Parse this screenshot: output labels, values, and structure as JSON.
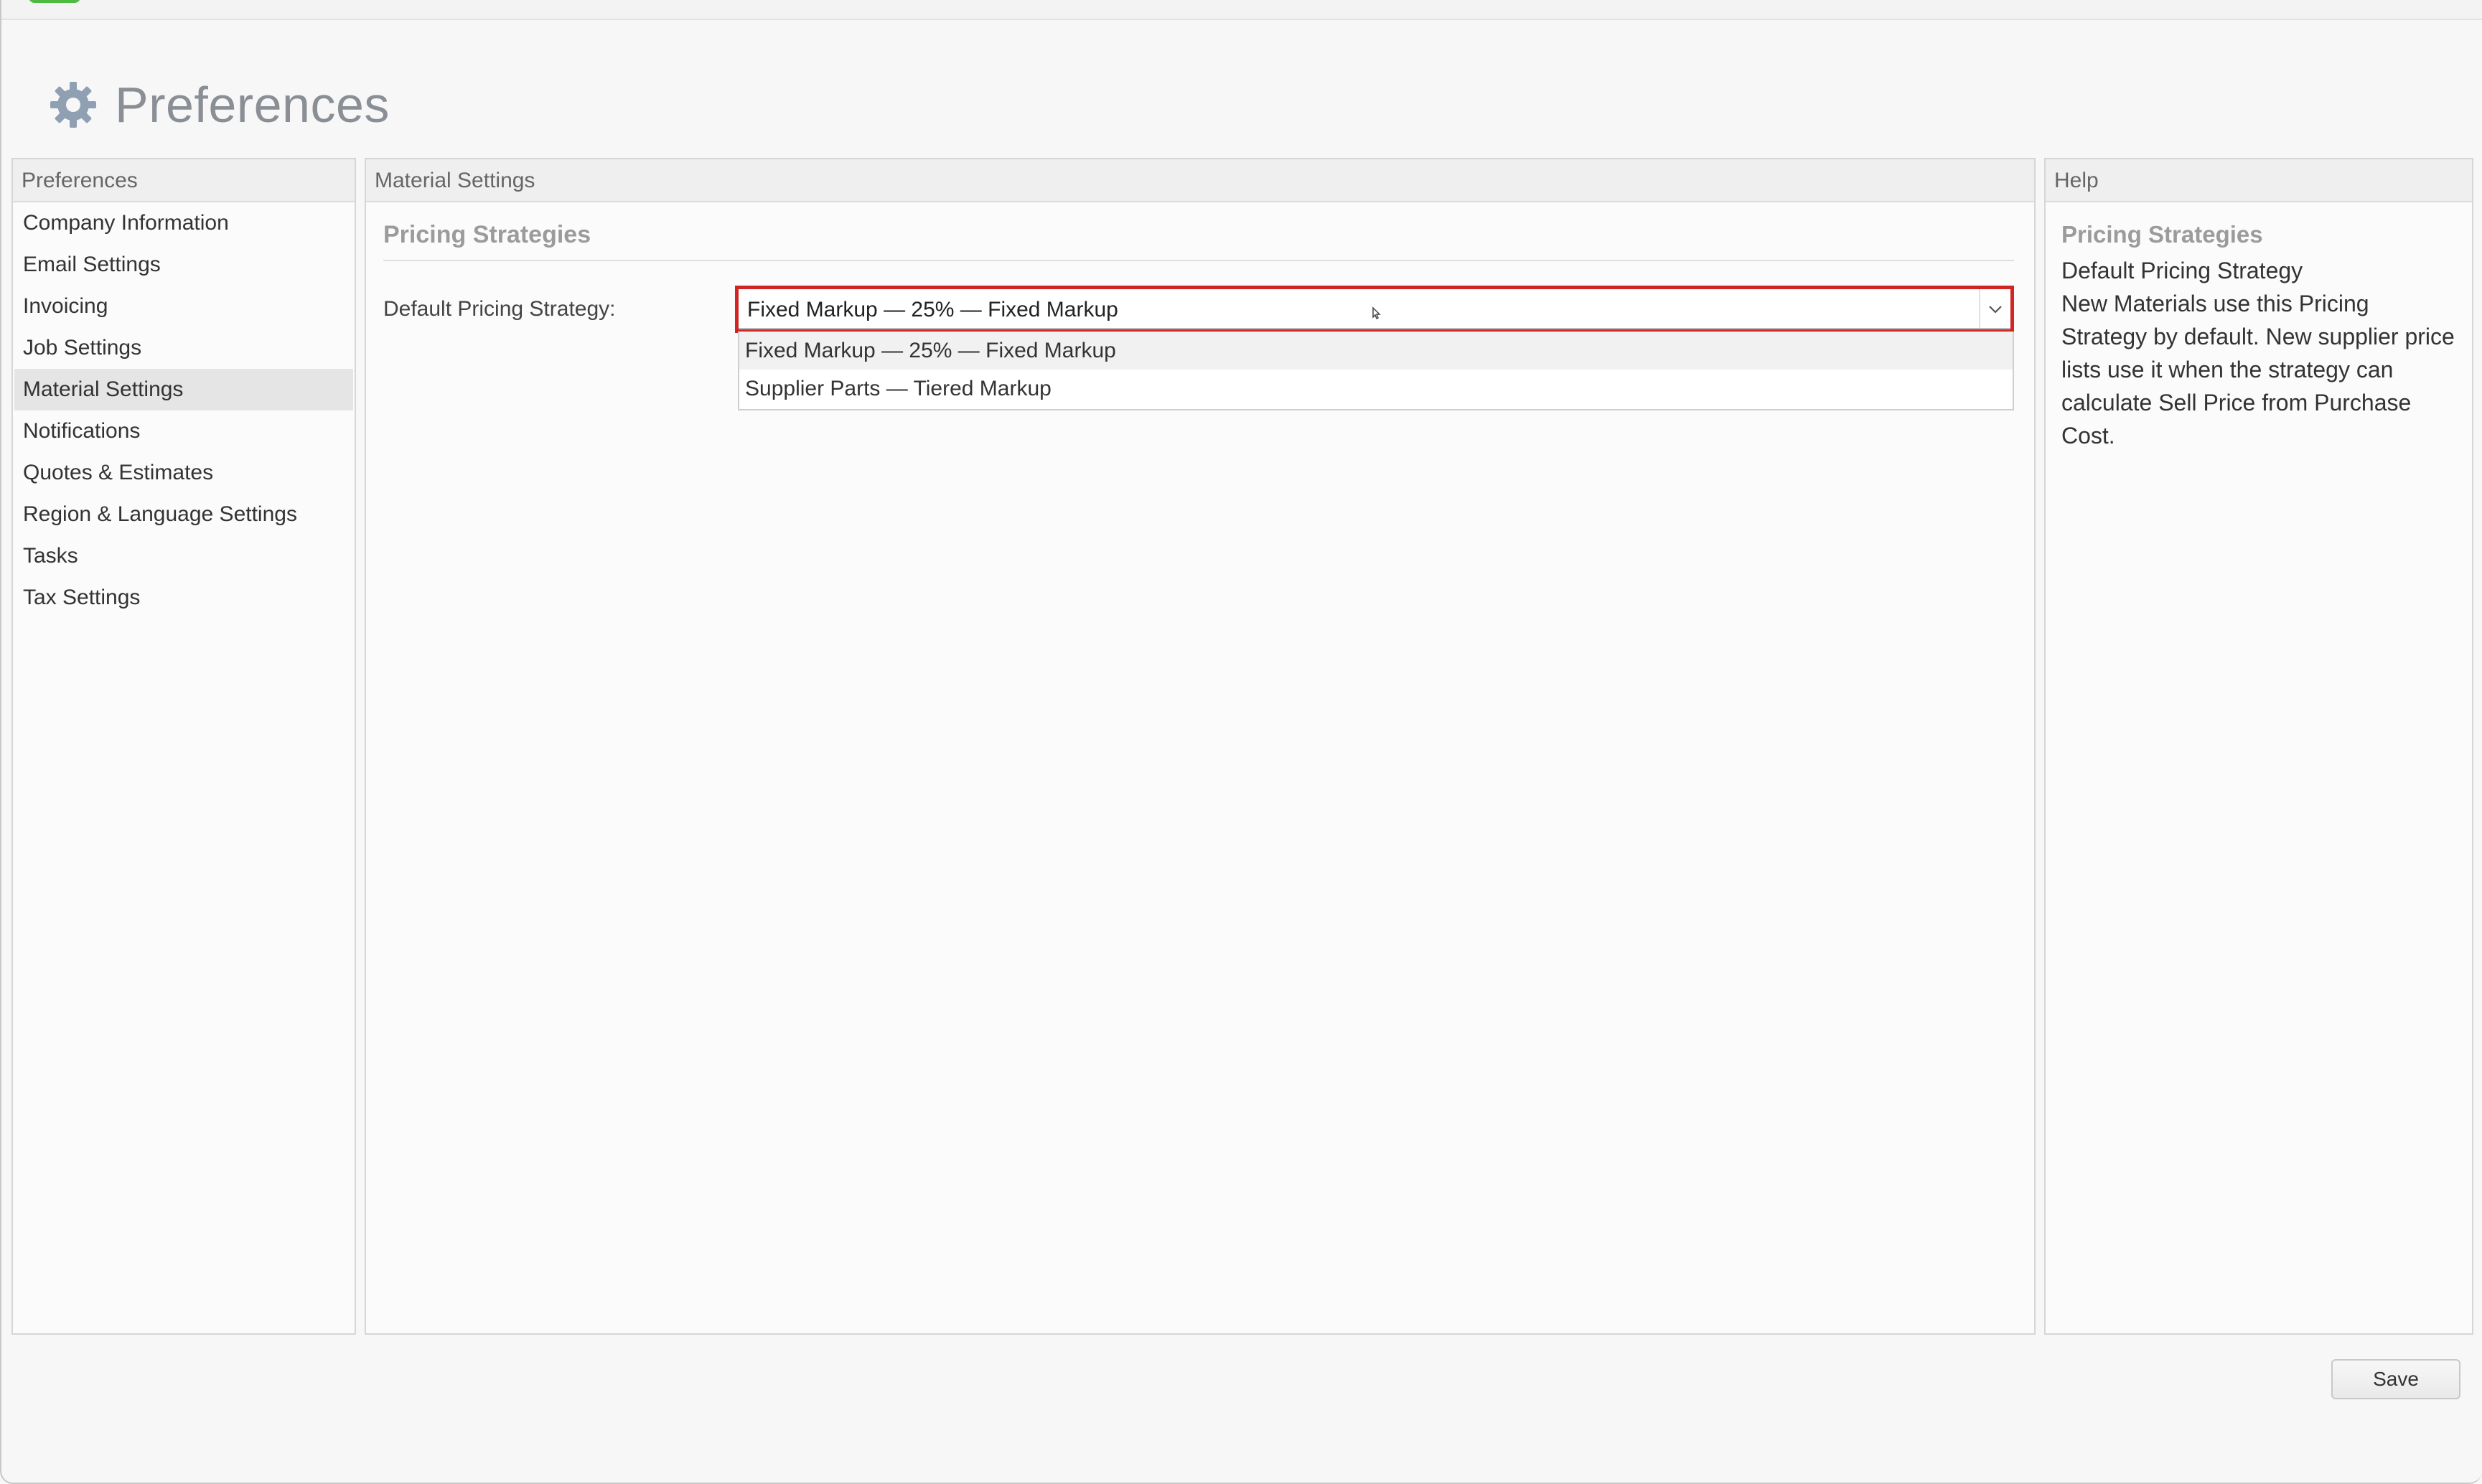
{
  "page": {
    "title": "Preferences"
  },
  "sidebar": {
    "header": "Preferences",
    "items": [
      {
        "label": "Company Information"
      },
      {
        "label": "Email Settings"
      },
      {
        "label": "Invoicing"
      },
      {
        "label": "Job Settings"
      },
      {
        "label": "Material Settings",
        "active": true
      },
      {
        "label": "Notifications"
      },
      {
        "label": "Quotes & Estimates"
      },
      {
        "label": "Region & Language Settings"
      },
      {
        "label": "Tasks"
      },
      {
        "label": "Tax Settings"
      }
    ]
  },
  "main": {
    "header": "Material Settings",
    "section_title": "Pricing Strategies",
    "field_label": "Default Pricing Strategy:",
    "select_value": "Fixed Markup — 25% — Fixed Markup",
    "options": [
      "Fixed Markup — 25% — Fixed Markup",
      "Supplier Parts — Tiered Markup"
    ]
  },
  "help": {
    "header": "Help",
    "title": "Pricing Strategies",
    "subtitle": "Default Pricing Strategy",
    "text": "New Materials use this Pricing Strategy by default. New supplier price lists use it when the strategy can calculate Sell Price from Purchase Cost."
  },
  "footer": {
    "save_label": "Save"
  },
  "colors": {
    "accent_focus": "#d32424",
    "brand_green": "#4cbb3f"
  }
}
